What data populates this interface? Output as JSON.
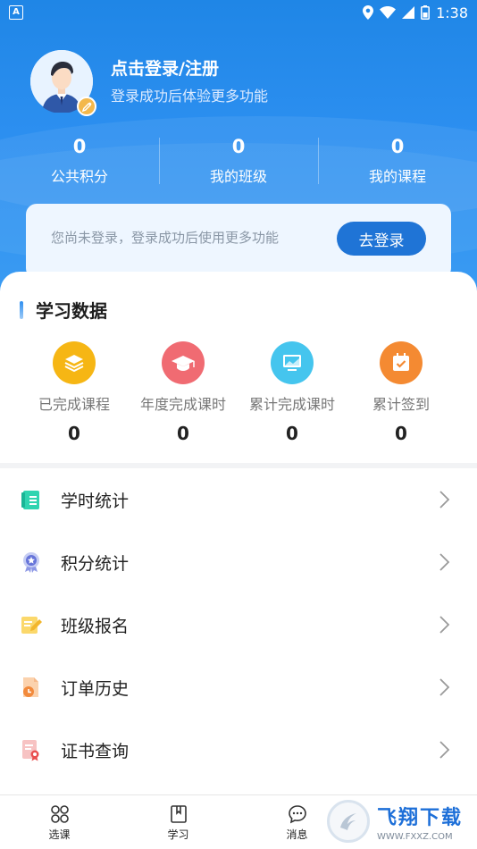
{
  "status_bar": {
    "left_icon": "A",
    "time": "1:38"
  },
  "profile": {
    "title": "点击登录/注册",
    "subtitle": "登录成功后体验更多功能"
  },
  "stats": [
    {
      "value": "0",
      "label": "公共积分"
    },
    {
      "value": "0",
      "label": "我的班级"
    },
    {
      "value": "0",
      "label": "我的课程"
    }
  ],
  "login_card": {
    "hint": "您尚未登录，登录成功后使用更多功能",
    "button": "去登录"
  },
  "study_data": {
    "title": "学习数据",
    "metrics": [
      {
        "label": "已完成课程",
        "value": "0",
        "color": "#f6b614",
        "icon": "layers-icon"
      },
      {
        "label": "年度完成课时",
        "value": "0",
        "color": "#f06b72",
        "icon": "graduation-cap-icon"
      },
      {
        "label": "累计完成课时",
        "value": "0",
        "color": "#45c5ee",
        "icon": "monitor-icon"
      },
      {
        "label": "累计签到",
        "value": "0",
        "color": "#f48a32",
        "icon": "calendar-check-icon"
      }
    ]
  },
  "menu": [
    {
      "label": "学时统计",
      "icon": "book-icon"
    },
    {
      "label": "积分统计",
      "icon": "medal-icon"
    },
    {
      "label": "班级报名",
      "icon": "edit-note-icon"
    },
    {
      "label": "订单历史",
      "icon": "order-history-icon"
    },
    {
      "label": "证书查询",
      "icon": "certificate-icon"
    }
  ],
  "tabs": [
    {
      "label": "选课",
      "icon": "grid-icon"
    },
    {
      "label": "学习",
      "icon": "bookmark-icon"
    },
    {
      "label": "消息",
      "icon": "chat-icon"
    }
  ],
  "watermark": {
    "title": "飞翔下载",
    "url": "WWW.FXXZ.COM"
  },
  "colors": {
    "brand_blue": "#1f86e6",
    "button_blue": "#1f74d6"
  }
}
